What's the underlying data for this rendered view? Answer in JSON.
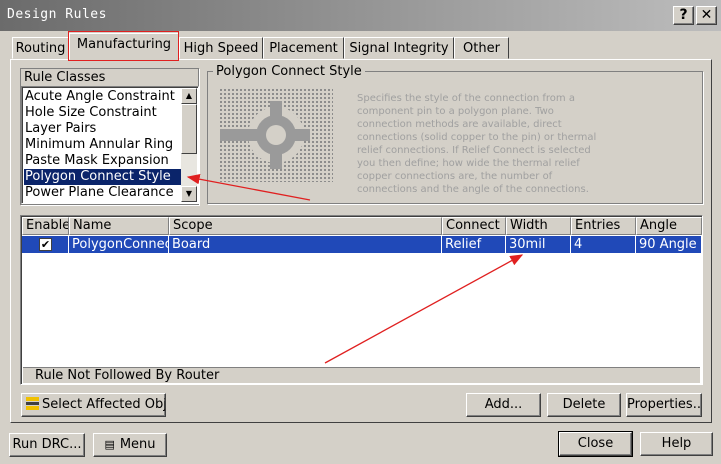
{
  "window": {
    "title": "Design Rules",
    "help_btn": "?",
    "close_btn": "✕"
  },
  "tabs": [
    {
      "label": "Routing"
    },
    {
      "label": "Manufacturing",
      "active": true
    },
    {
      "label": "High Speed"
    },
    {
      "label": "Placement"
    },
    {
      "label": "Signal Integrity"
    },
    {
      "label": "Other"
    }
  ],
  "rule_classes": {
    "heading": "Rule Classes",
    "items": [
      "Acute Angle Constraint",
      "Hole Size Constraint",
      "Layer Pairs",
      "Minimum Annular Ring",
      "Paste Mask Expansion",
      "Polygon Connect Style",
      "Power Plane Clearance"
    ],
    "selected": "Polygon Connect Style"
  },
  "detail": {
    "heading": "Polygon Connect Style",
    "description": "Specifies the style of the connection from a component pin to a polygon plane. Two connection methods are available, direct connections (solid copper to the pin) or thermal relief connections. If Relief Connect is selected you then define; how wide the thermal relief copper connections are, the number of connections and the angle of the connections."
  },
  "grid": {
    "columns": {
      "enable": "Enable",
      "name": "Name",
      "scope": "Scope",
      "connect": "Connect",
      "width": "Width",
      "entries": "Entries",
      "angle": "Angle"
    },
    "rows": [
      {
        "enabled": true,
        "name": "PolygonConnect",
        "scope": "Board",
        "connect": "Relief",
        "width": "30mil",
        "entries": "4",
        "angle": "90 Angle"
      }
    ],
    "footer": "Rule Not Followed By Router"
  },
  "buttons": {
    "select_affected": "Select Affected Objects",
    "add": "Add...",
    "delete": "Delete",
    "properties": "Properties...",
    "run_drc": "Run DRC...",
    "menu": "Menu",
    "close": "Close",
    "help": "Help"
  },
  "colors": {
    "annotation_red": "#e02020",
    "selection_blue": "#2049b8",
    "list_selection": "#0a246a"
  }
}
